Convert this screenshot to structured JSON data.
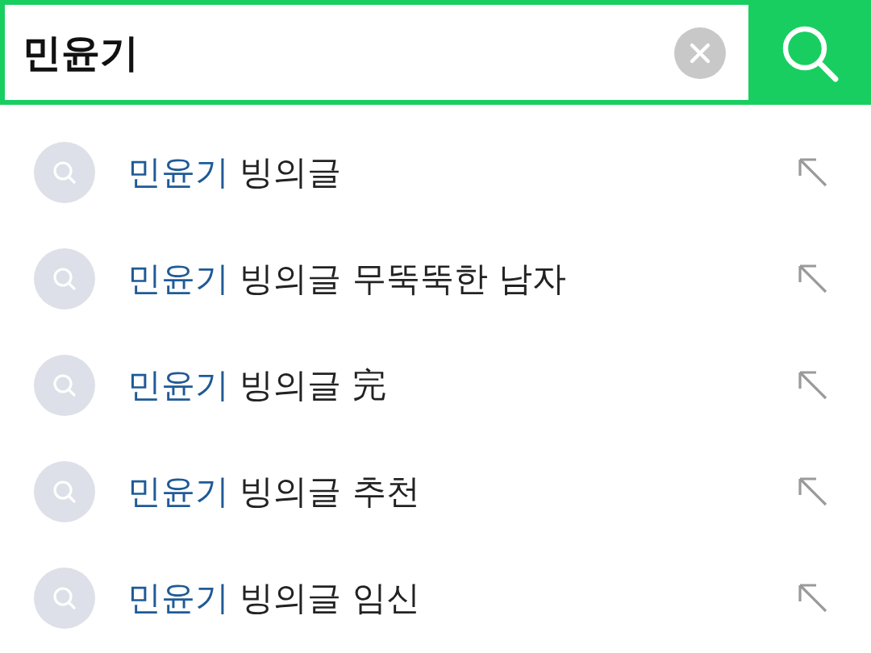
{
  "search": {
    "value": "민윤기"
  },
  "suggestions": [
    {
      "highlight": "민윤기",
      "rest": " 빙의글"
    },
    {
      "highlight": "민윤기",
      "rest": " 빙의글 무뚝뚝한 남자"
    },
    {
      "highlight": "민윤기",
      "rest": " 빙의글 完"
    },
    {
      "highlight": "민윤기",
      "rest": " 빙의글 추천"
    },
    {
      "highlight": "민윤기",
      "rest": " 빙의글 임신"
    }
  ]
}
